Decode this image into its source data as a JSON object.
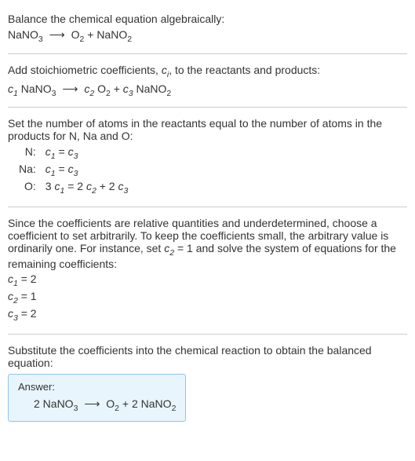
{
  "section1": {
    "intro": "Balance the chemical equation algebraically:",
    "eq_r1": "NaNO",
    "eq_r1_sub": "3",
    "arrow": "⟶",
    "eq_p1": "O",
    "eq_p1_sub": "2",
    "plus": " + ",
    "eq_p2": "NaNO",
    "eq_p2_sub": "2"
  },
  "section2": {
    "intro_a": "Add stoichiometric coefficients, ",
    "ci": "c",
    "ci_sub": "i",
    "intro_b": ", to the reactants and products:",
    "c1": "c",
    "c1_sub": "1",
    "r1": " NaNO",
    "r1_sub": "3",
    "arrow": "⟶",
    "c2": "c",
    "c2_sub": "2",
    "p1": " O",
    "p1_sub": "2",
    "plus": " + ",
    "c3": "c",
    "c3_sub": "3",
    "p2": " NaNO",
    "p2_sub": "2"
  },
  "section3": {
    "intro": "Set the number of atoms in the reactants equal to the number of atoms in the products for N, Na and O:",
    "rows": {
      "n_label": "N:",
      "n_lhs_c": "c",
      "n_lhs_sub": "1",
      "n_eq": " = ",
      "n_rhs_c": "c",
      "n_rhs_sub": "3",
      "na_label": "Na:",
      "na_lhs_c": "c",
      "na_lhs_sub": "1",
      "na_eq": " = ",
      "na_rhs_c": "c",
      "na_rhs_sub": "3",
      "o_label": "O:",
      "o_lhs_pre": "3 ",
      "o_lhs_c": "c",
      "o_lhs_sub": "1",
      "o_eq": " = ",
      "o_rhs1_pre": "2 ",
      "o_rhs1_c": "c",
      "o_rhs1_sub": "2",
      "o_plus": " + ",
      "o_rhs2_pre": "2 ",
      "o_rhs2_c": "c",
      "o_rhs2_sub": "3"
    }
  },
  "section4": {
    "intro_a": "Since the coefficients are relative quantities and underdetermined, choose a coefficient to set arbitrarily. To keep the coefficients small, the arbitrary value is ordinarily one. For instance, set ",
    "c2": "c",
    "c2_sub": "2",
    "c2_val": " = 1",
    "intro_b": " and solve the system of equations for the remaining coefficients:",
    "line1_c": "c",
    "line1_sub": "1",
    "line1_rest": " = 2",
    "line2_c": "c",
    "line2_sub": "2",
    "line2_rest": " = 1",
    "line3_c": "c",
    "line3_sub": "3",
    "line3_rest": " = 2"
  },
  "section5": {
    "intro": "Substitute the coefficients into the chemical reaction to obtain the balanced equation:",
    "answer_label": "Answer:",
    "ans_r1_pre": "2 NaNO",
    "ans_r1_sub": "3",
    "arrow": "⟶",
    "ans_p1": "O",
    "ans_p1_sub": "2",
    "plus": " + ",
    "ans_p2_pre": "2 NaNO",
    "ans_p2_sub": "2"
  }
}
